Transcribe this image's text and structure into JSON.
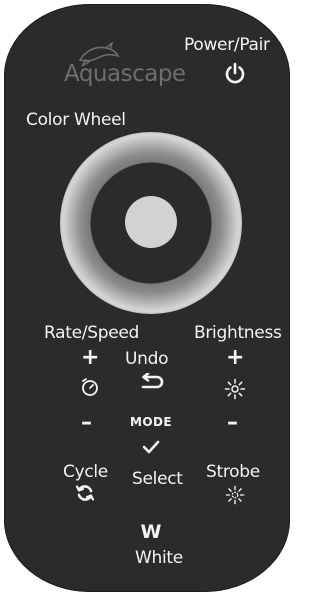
{
  "remote": {
    "logo": {
      "text": "Aquascape",
      "icon": "koi-fish-logo"
    },
    "power": {
      "label": "Power/Pair",
      "icon": "power-icon"
    },
    "color_wheel": {
      "label": "Color Wheel"
    },
    "rate_speed": {
      "label": "Rate/Speed",
      "plus": "+",
      "minus": "–",
      "icon": "timer-icon"
    },
    "brightness": {
      "label": "Brightness",
      "plus": "+",
      "minus": "–",
      "icon": "sun-icon"
    },
    "undo": {
      "label": "Undo",
      "icon": "undo-arrow-icon"
    },
    "mode": {
      "label": "MODE"
    },
    "select": {
      "label": "Select",
      "icon": "checkmark-icon"
    },
    "cycle": {
      "label": "Cycle",
      "icon": "cycle-arrows-icon"
    },
    "strobe": {
      "label": "Strobe",
      "icon": "strobe-sun-icon"
    },
    "white": {
      "label": "White",
      "letter": "W"
    }
  },
  "colors": {
    "body": "#2b2b2b",
    "text": "#f4f4f4",
    "wheel_ring": "#c8c8c8",
    "logo": "#6e6e6e"
  }
}
